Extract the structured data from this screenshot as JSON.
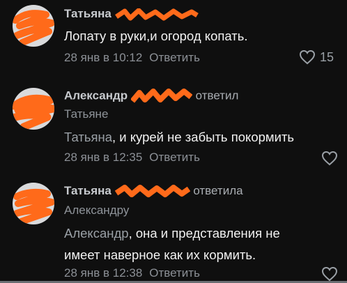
{
  "comments": [
    {
      "author": "Татьяна",
      "text": "Лопату в руки,и огород копать.",
      "date": "28 янв в 10:12",
      "reply": "Ответить",
      "likes": "15"
    },
    {
      "author": "Александр",
      "action": "ответил",
      "reply_to": "Татьяне",
      "mention": "Татьяна",
      "text": ", и курей не забыть покормить",
      "date": "28 янв в 12:35",
      "reply": "Ответить"
    },
    {
      "author": "Татьяна",
      "action": "ответила",
      "reply_to": "Александру",
      "mention": "Александр",
      "text": ", она и представления не",
      "text2": "имеет наверное как их кормить.",
      "date": "28 янв в 12:38",
      "reply": "Ответить"
    }
  ],
  "colors": {
    "redaction": "#ff6a1a",
    "background": "#0f0f0f",
    "avatar": "#d9dadc"
  },
  "icons": {
    "like": "heart-icon"
  }
}
